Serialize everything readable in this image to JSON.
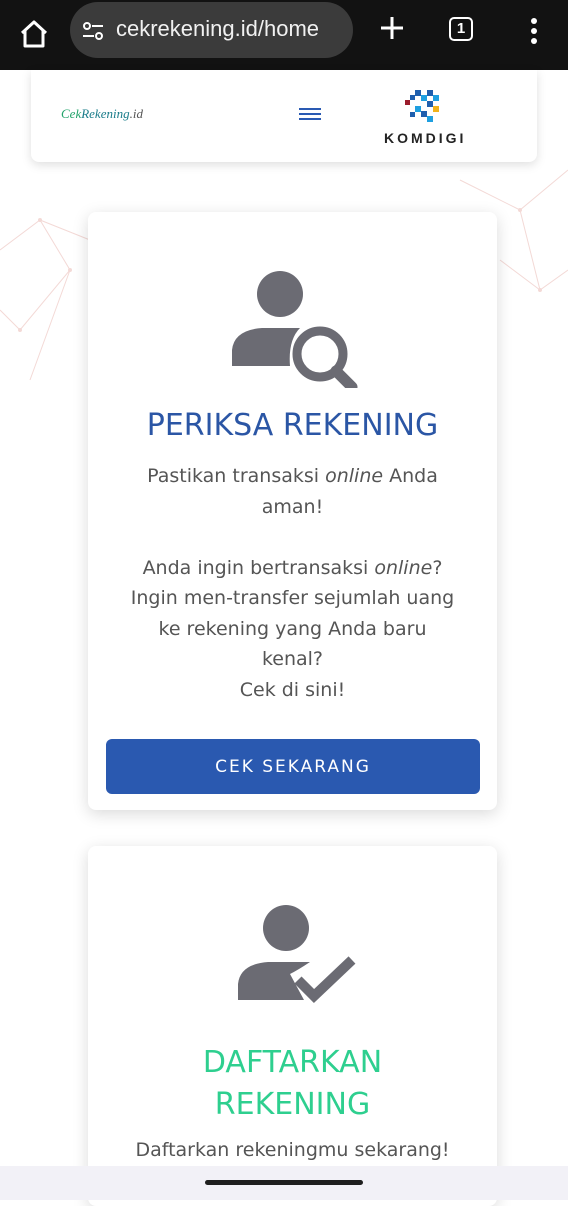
{
  "browser": {
    "url": "cekrekening.id/home",
    "tab_count": "1",
    "icons": [
      "home-icon",
      "site-settings-icon",
      "plus-icon",
      "tabs-icon",
      "more-vert-icon"
    ]
  },
  "header": {
    "logo_part1": "Cek",
    "logo_part2": "Rekening",
    "logo_part3": ".id",
    "partner_name": "KOMDIGI"
  },
  "cards": [
    {
      "icon": "user-search-icon",
      "title": "PERIKSA REKENING",
      "lines": [
        [
          "Pastikan transaksi ",
          "online",
          " Anda"
        ],
        [
          "aman!"
        ],
        [],
        [
          "Anda ingin bertransaksi ",
          "online",
          "?"
        ],
        [
          "Ingin men-transfer sejumlah uang"
        ],
        [
          "ke rekening yang Anda baru"
        ],
        [
          "kenal?"
        ],
        [
          "Cek di sini!"
        ]
      ],
      "button_label": "CEK SEKARANG"
    },
    {
      "icon": "user-check-icon",
      "title_line1": "DAFTARKAN",
      "title_line2": "REKENING",
      "text": "Daftarkan rekeningmu sekarang!"
    }
  ],
  "colors": {
    "primary_blue": "#2a59b0",
    "title_blue": "#2b56a5",
    "accent_green": "#2ecf8f",
    "icon_gray": "#6b6b73"
  }
}
